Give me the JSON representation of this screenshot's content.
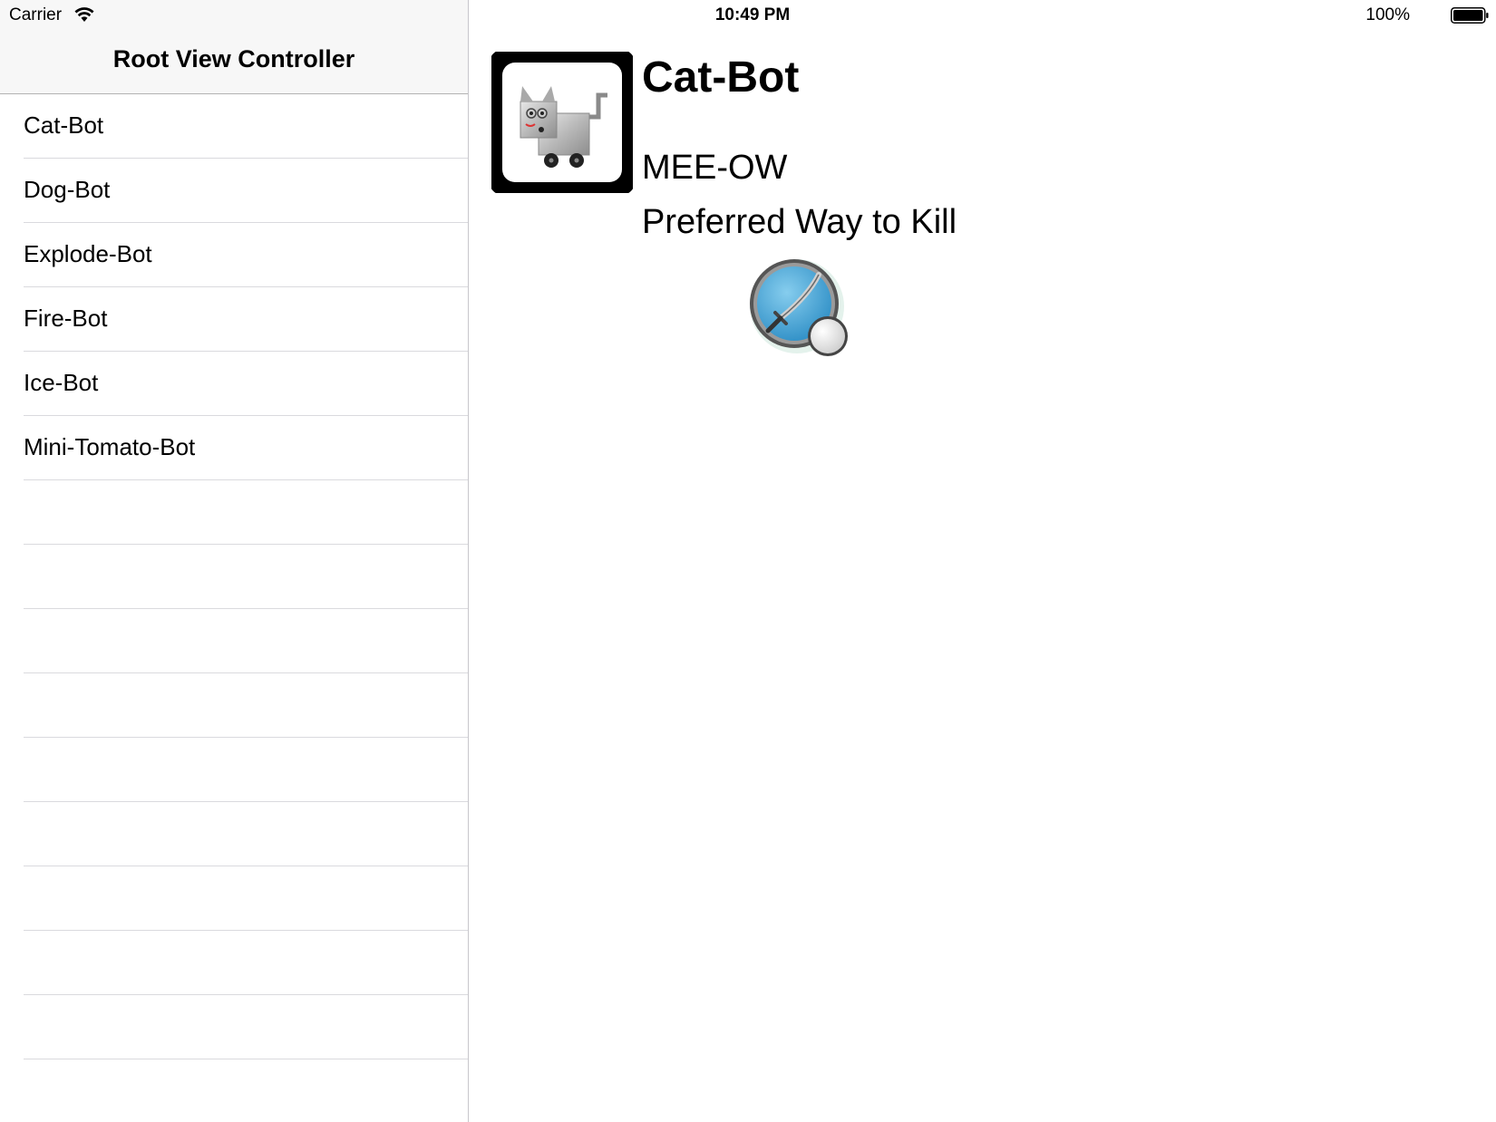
{
  "status_bar": {
    "carrier": "Carrier",
    "time": "10:49 PM",
    "battery": "100%"
  },
  "master": {
    "title": "Root View Controller",
    "items": [
      {
        "label": "Cat-Bot"
      },
      {
        "label": "Dog-Bot"
      },
      {
        "label": "Explode-Bot"
      },
      {
        "label": "Fire-Bot"
      },
      {
        "label": "Ice-Bot"
      },
      {
        "label": "Mini-Tomato-Bot"
      },
      {
        "label": ""
      },
      {
        "label": ""
      },
      {
        "label": ""
      },
      {
        "label": ""
      },
      {
        "label": ""
      },
      {
        "label": ""
      },
      {
        "label": ""
      },
      {
        "label": ""
      },
      {
        "label": ""
      },
      {
        "label": ""
      }
    ]
  },
  "detail": {
    "name": "Cat-Bot",
    "sound": "MEE-OW",
    "kill_label": "Preferred Way to Kill",
    "portrait_icon": "cat-robot-icon",
    "weapon_icon": "sword-icon"
  },
  "colors": {
    "nav_background": "#f7f7f7",
    "separator": "#dadade",
    "weapon_blue": "#4fa8d8"
  }
}
